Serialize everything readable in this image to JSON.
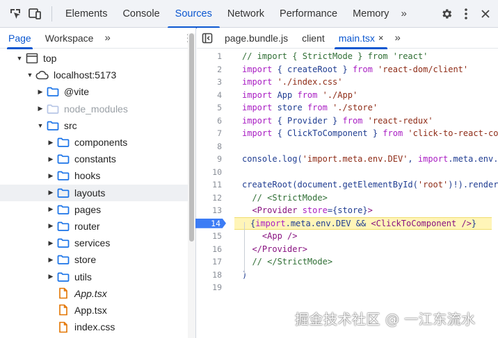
{
  "toolbar": {
    "tabs": [
      "Elements",
      "Console",
      "Sources",
      "Network",
      "Performance",
      "Memory"
    ],
    "active_tab": "Sources",
    "more": "»"
  },
  "navigator": {
    "tabs": [
      "Page",
      "Workspace"
    ],
    "active_tab": "Page",
    "more": "»",
    "tree": [
      {
        "label": "top",
        "depth": 0,
        "arrow": "open",
        "icon": "frame-icon"
      },
      {
        "label": "localhost:5173",
        "depth": 1,
        "arrow": "open",
        "icon": "cloud-icon"
      },
      {
        "label": "@vite",
        "depth": 2,
        "arrow": "closed",
        "icon": "folder-icon"
      },
      {
        "label": "node_modules",
        "depth": 2,
        "arrow": "closed",
        "icon": "folder-icon",
        "dim": true
      },
      {
        "label": "src",
        "depth": 2,
        "arrow": "open",
        "icon": "folder-icon"
      },
      {
        "label": "components",
        "depth": 3,
        "arrow": "closed",
        "icon": "folder-icon"
      },
      {
        "label": "constants",
        "depth": 3,
        "arrow": "closed",
        "icon": "folder-icon"
      },
      {
        "label": "hooks",
        "depth": 3,
        "arrow": "closed",
        "icon": "folder-icon"
      },
      {
        "label": "layouts",
        "depth": 3,
        "arrow": "closed",
        "icon": "folder-icon",
        "selected": true
      },
      {
        "label": "pages",
        "depth": 3,
        "arrow": "closed",
        "icon": "folder-icon"
      },
      {
        "label": "router",
        "depth": 3,
        "arrow": "closed",
        "icon": "folder-icon"
      },
      {
        "label": "services",
        "depth": 3,
        "arrow": "closed",
        "icon": "folder-icon"
      },
      {
        "label": "store",
        "depth": 3,
        "arrow": "closed",
        "icon": "folder-icon"
      },
      {
        "label": "utils",
        "depth": 3,
        "arrow": "closed",
        "icon": "folder-icon"
      },
      {
        "label": "App.tsx",
        "depth": 3,
        "arrow": "none",
        "icon": "file-icon",
        "italic": true
      },
      {
        "label": "App.tsx",
        "depth": 3,
        "arrow": "none",
        "icon": "file-icon"
      },
      {
        "label": "index.css",
        "depth": 3,
        "arrow": "none",
        "icon": "file-icon"
      }
    ]
  },
  "editor": {
    "tabs": [
      {
        "label": "page.bundle.js",
        "active": false
      },
      {
        "label": "client",
        "active": false
      },
      {
        "label": "main.tsx",
        "active": true,
        "close": "×"
      }
    ],
    "more": "»",
    "breakpoint_line": 14,
    "lines": [
      [
        [
          "cm",
          "// import { StrictMode } from 'react'"
        ]
      ],
      [
        [
          "kw",
          "import "
        ],
        [
          "id",
          "{ createRoot } "
        ],
        [
          "kw",
          "from "
        ],
        [
          "str",
          "'react-dom/client'"
        ]
      ],
      [
        [
          "kw",
          "import "
        ],
        [
          "str",
          "'./index.css'"
        ]
      ],
      [
        [
          "kw",
          "import "
        ],
        [
          "id",
          "App "
        ],
        [
          "kw",
          "from "
        ],
        [
          "str",
          "'./App'"
        ]
      ],
      [
        [
          "kw",
          "import "
        ],
        [
          "id",
          "store "
        ],
        [
          "kw",
          "from "
        ],
        [
          "str",
          "'./store'"
        ]
      ],
      [
        [
          "kw",
          "import "
        ],
        [
          "id",
          "{ Provider } "
        ],
        [
          "kw",
          "from "
        ],
        [
          "str",
          "'react-redux'"
        ]
      ],
      [
        [
          "kw",
          "import "
        ],
        [
          "id",
          "{ ClickToComponent } "
        ],
        [
          "kw",
          "from "
        ],
        [
          "str",
          "'click-to-react-com"
        ]
      ],
      [],
      [
        [
          "id",
          "console.log("
        ],
        [
          "str",
          "'import.meta.env.DEV'"
        ],
        [
          "id",
          ", "
        ],
        [
          "kw",
          "import"
        ],
        [
          "id",
          ".meta.env.]"
        ]
      ],
      [],
      [
        [
          "id",
          "createRoot(document.getElementById("
        ],
        [
          "str",
          "'root'"
        ],
        [
          "id",
          ")!).render"
        ]
      ],
      [
        [
          "cm",
          "  // <StrictMode>"
        ]
      ],
      [
        [
          "tag",
          "  <Provider "
        ],
        [
          "kw",
          "store"
        ],
        [
          "id",
          "={store}"
        ],
        [
          "tag",
          ">"
        ]
      ],
      [
        [
          "id",
          "{"
        ],
        [
          "kw",
          "import"
        ],
        [
          "id",
          ".meta.env.DEV && "
        ],
        [
          "tag",
          "<ClickToComponent />"
        ],
        [
          "id",
          "}"
        ]
      ],
      [
        [
          "tag",
          "    <App />"
        ]
      ],
      [
        [
          "tag",
          "  </Provider>"
        ]
      ],
      [
        [
          "cm",
          "  // </StrictMode>"
        ]
      ],
      [
        [
          "id",
          ")"
        ]
      ],
      []
    ]
  },
  "watermark": "掘金技术社区 @ 一江东流水",
  "colors": {
    "accent": "#0b57d0",
    "folder": "#1a73e8",
    "file": "#e37400",
    "breakpoint": "#3c7cf5"
  }
}
